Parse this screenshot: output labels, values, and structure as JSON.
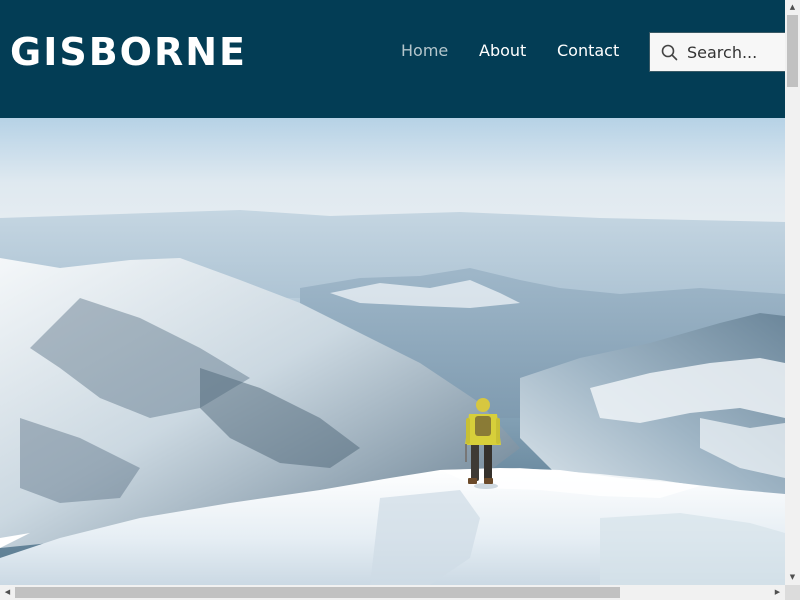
{
  "site": {
    "logo": "GISBORNE"
  },
  "nav": {
    "items": [
      {
        "label": "Home",
        "active": true
      },
      {
        "label": "About",
        "active": false
      },
      {
        "label": "Contact",
        "active": false
      }
    ]
  },
  "search": {
    "placeholder": "Search..."
  },
  "hero": {
    "image": "snowy-mountain-summit-hiker"
  },
  "colors": {
    "header_bg": "#033d55",
    "logo_text": "#ffffff",
    "nav_text": "#ffffff",
    "nav_active": "#b4c6cc"
  },
  "icons": {
    "search": "magnifier-icon",
    "scroll_up": "triangle-up",
    "scroll_down": "triangle-down",
    "scroll_left": "triangle-left",
    "scroll_right": "triangle-right"
  }
}
